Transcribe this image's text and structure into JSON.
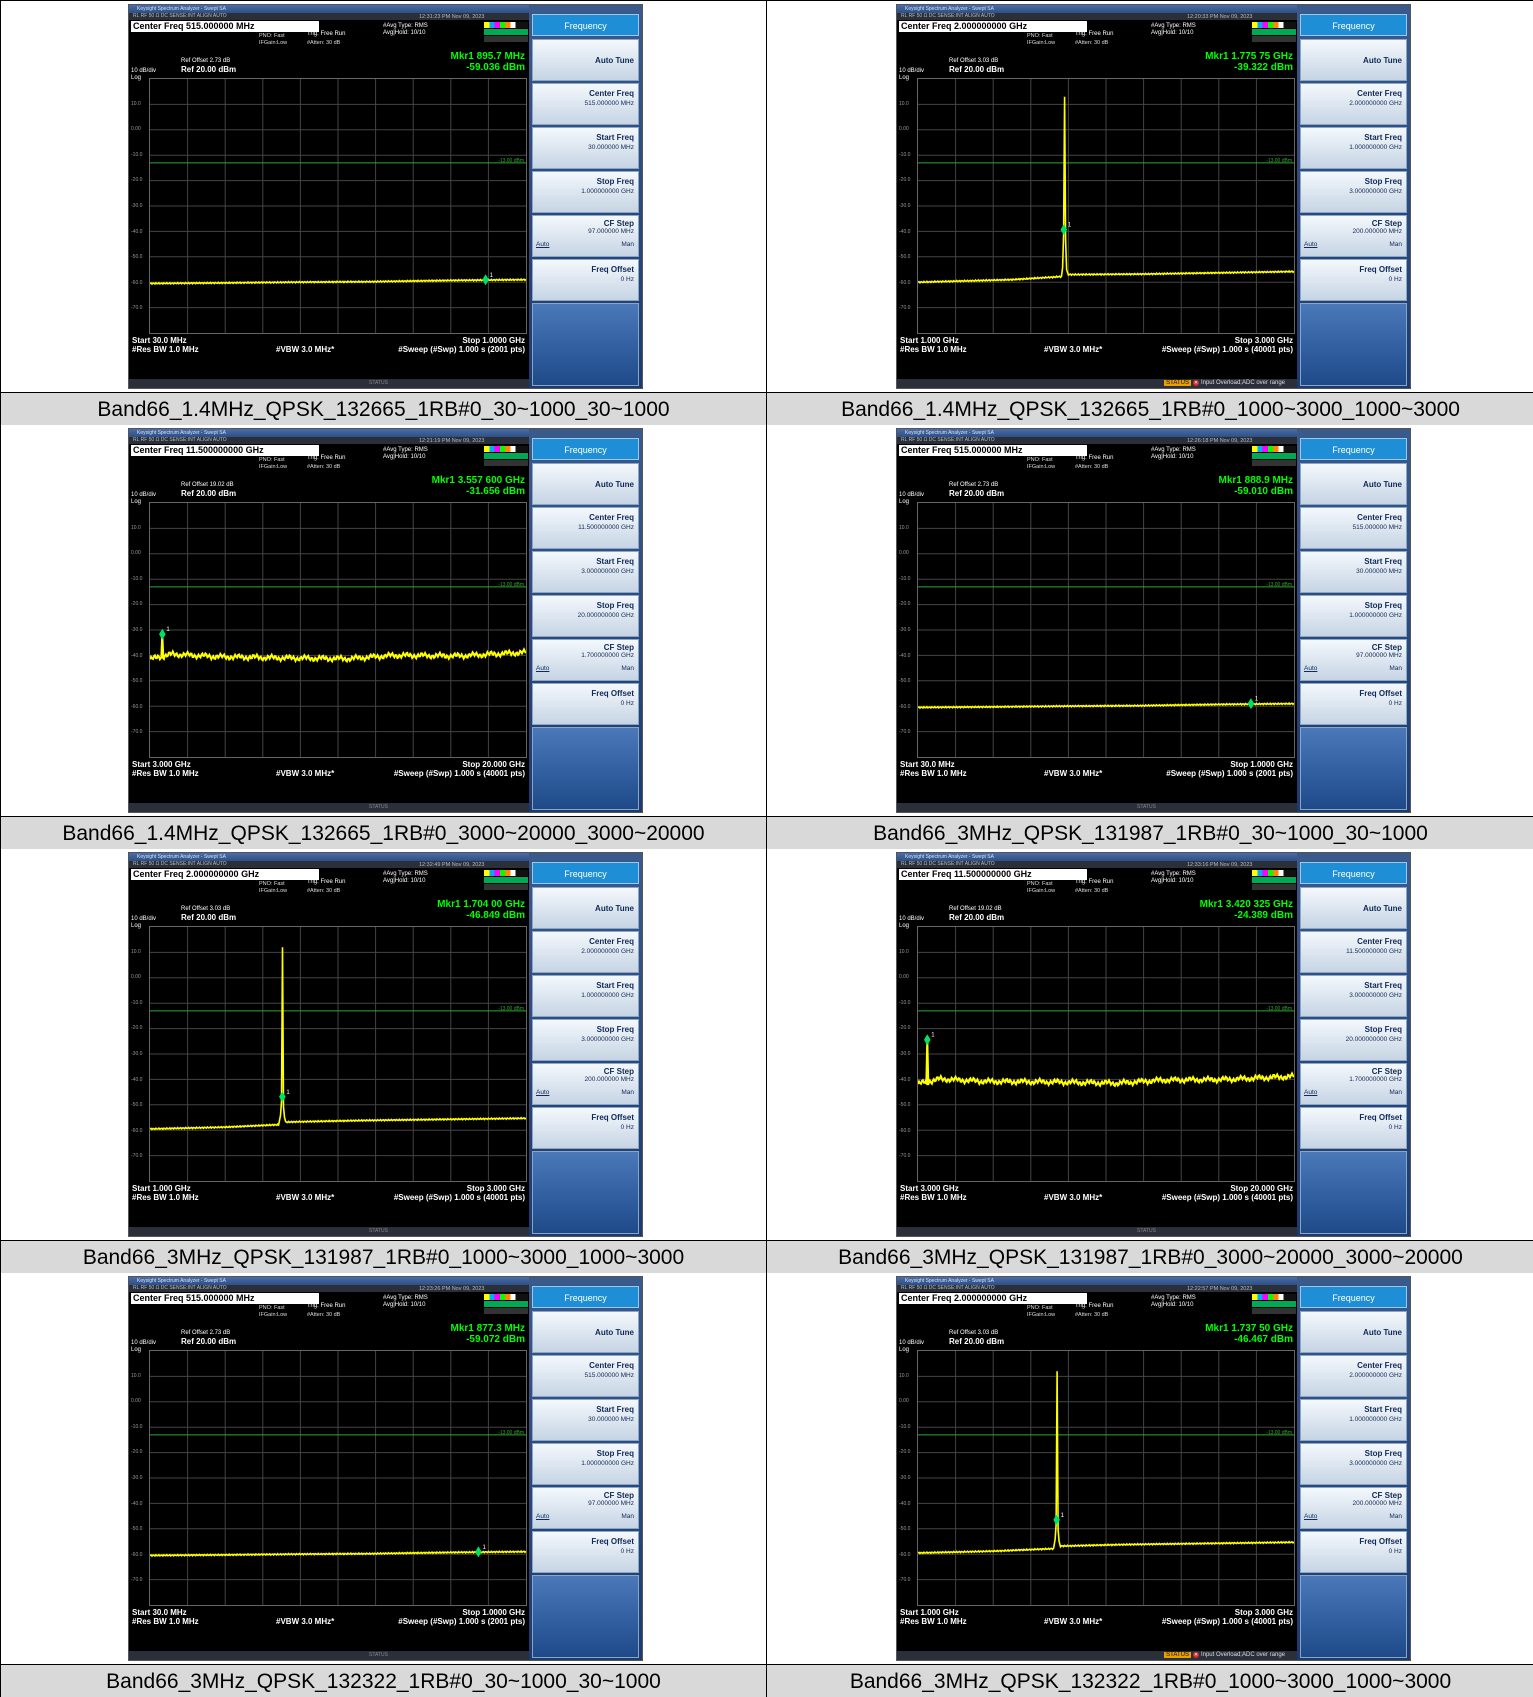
{
  "captions": [
    "Band66_1.4MHz_QPSK_132665_1RB#0_30~1000_30~1000",
    "Band66_1.4MHz_QPSK_132665_1RB#0_1000~3000_1000~3000",
    "Band66_1.4MHz_QPSK_132665_1RB#0_3000~20000_3000~20000",
    "Band66_3MHz_QPSK_131987_1RB#0_30~1000_30~1000",
    "Band66_3MHz_QPSK_131987_1RB#0_1000~3000_1000~3000",
    "Band66_3MHz_QPSK_131987_1RB#0_3000~20000_3000~20000",
    "Band66_3MHz_QPSK_132322_1RB#0_30~1000_30~1000",
    "Band66_3MHz_QPSK_132322_1RB#0_1000~3000_1000~3000"
  ],
  "common": {
    "window_title": "Keysight Spectrum Analyzer - Swept SA",
    "status_left": "RL          RF     50 Ω  DC                SENSE:INT                  ALIGN AUTO",
    "avg_type": "#Avg Type: RMS",
    "avg_hold": "Avg|Hold: 10/10",
    "pno": "PNO: Fast",
    "ifgain": "IFGain:Low",
    "trig": "Trig: Free Run",
    "atten": "#Atten: 30 dB",
    "ref_level": "Ref 20.00 dBm",
    "scale": "10 dB/div",
    "log": "Log",
    "res_bw": "#Res BW 1.0 MHz",
    "vbw": "#VBW 3.0 MHz*",
    "status_label": "STATUS",
    "menu_title": "Frequency",
    "auto_tune": "Auto Tune",
    "center_freq_lbl": "Center Freq",
    "start_freq_lbl": "Start Freq",
    "stop_freq_lbl": "Stop Freq",
    "cf_step_lbl": "CF Step",
    "freq_offset_lbl": "Freq Offset",
    "freq_offset_val": "0 Hz",
    "auto": "Auto",
    "man": "Man",
    "overload_msg": "Input Overload;ADC over range",
    "y_labels": [
      "10.0",
      "0.00",
      "-10.0",
      "-20.0",
      "-30.0",
      "-40.0",
      "-50.0",
      "-60.0",
      "-70.0"
    ],
    "limit_label": "-13.00 dBm"
  },
  "shots": [
    {
      "time": "12:31:23 PM Nov 09, 2023",
      "center": "Center Freq 515.000000 MHz",
      "ref_offset": "Ref Offset 2.73 dB",
      "mkr_freq": "Mkr1 895.7 MHz",
      "mkr_amp": "-59.036 dBm",
      "start": "Start 30.0 MHz",
      "stop": "Stop 1.0000 GHz",
      "sweep": "#Sweep (#Swp)  1.000 s (2001 pts)",
      "m_center": "515.000000 MHz",
      "m_start": "30.000000 MHz",
      "m_stop": "1.000000000 GHz",
      "m_cfstep": "97.000000 MHz",
      "overload": false,
      "chart_data": {
        "type": "line",
        "x_range": [
          30,
          1000
        ],
        "x_unit": "MHz",
        "ylim": [
          -80,
          20
        ],
        "limit_dBm": -13,
        "marker": {
          "x": 895.7,
          "y": -59.036
        },
        "series": [
          {
            "x": [
              30,
              200,
              400,
              600,
              800,
              1000
            ],
            "values": [
              -60.5,
              -60.3,
              -60.0,
              -59.8,
              -59.3,
              -59.0
            ]
          }
        ]
      }
    },
    {
      "time": "12:20:33 PM Nov 09, 2023",
      "center": "Center Freq 2.000000000 GHz",
      "ref_offset": "Ref Offset 3.03 dB",
      "mkr_freq": "Mkr1 1.775 75 GHz",
      "mkr_amp": "-39.322 dBm",
      "start": "Start 1.000 GHz",
      "stop": "Stop 3.000 GHz",
      "sweep": "#Sweep (#Swp)  1.000 s (40001 pts)",
      "m_center": "2.000000000 GHz",
      "m_start": "1.000000000 GHz",
      "m_stop": "3.000000000 GHz",
      "m_cfstep": "200.000000 MHz",
      "overload": true,
      "chart_data": {
        "type": "line",
        "x_range": [
          1000,
          3000
        ],
        "x_unit": "MHz",
        "ylim": [
          -80,
          20
        ],
        "limit_dBm": -13,
        "marker": {
          "x": 1775.75,
          "y": -39.322
        },
        "peak": {
          "x": 1780,
          "y": 13
        },
        "series": [
          {
            "x": [
              1000,
              1500,
              1760,
              1800,
              2200,
              2600,
              3000
            ],
            "values": [
              -60.0,
              -59.0,
              -57.8,
              -57.0,
              -56.8,
              -56.3,
              -55.8
            ]
          }
        ]
      }
    },
    {
      "time": "12:21:19 PM Nov 09, 2023",
      "center": "Center Freq 11.500000000 GHz",
      "ref_offset": "Ref Offset 19.02 dB",
      "mkr_freq": "Mkr1 3.557 600 GHz",
      "mkr_amp": "-31.656 dBm",
      "start": "Start 3.000 GHz",
      "stop": "Stop 20.000 GHz",
      "sweep": "#Sweep (#Swp)  1.000 s (40001 pts)",
      "m_center": "11.500000000 GHz",
      "m_start": "3.000000000 GHz",
      "m_stop": "20.000000000 GHz",
      "m_cfstep": "1.700000000 GHz",
      "overload": false,
      "chart_data": {
        "type": "line",
        "x_range": [
          3000,
          20000
        ],
        "x_unit": "MHz",
        "ylim": [
          -80,
          20
        ],
        "limit_dBm": -13,
        "marker": {
          "x": 3557.6,
          "y": -31.656
        },
        "series": [
          {
            "x": [
              3000,
              4000,
              6000,
              9000,
              12000,
              14000,
              17000,
              20000
            ],
            "values": [
              -41.5,
              -39.5,
              -40.5,
              -41.0,
              -41.3,
              -40.0,
              -40.2,
              -38.8
            ]
          }
        ]
      }
    },
    {
      "time": "12:26:18 PM Nov 09, 2023",
      "center": "Center Freq 515.000000 MHz",
      "ref_offset": "Ref Offset 2.73 dB",
      "mkr_freq": "Mkr1 888.9 MHz",
      "mkr_amp": "-59.010 dBm",
      "start": "Start 30.0 MHz",
      "stop": "Stop 1.0000 GHz",
      "sweep": "#Sweep (#Swp)  1.000 s (2001 pts)",
      "m_center": "515.000000 MHz",
      "m_start": "30.000000 MHz",
      "m_stop": "1.000000000 GHz",
      "m_cfstep": "97.000000 MHz",
      "overload": false,
      "chart_data": {
        "type": "line",
        "x_range": [
          30,
          1000
        ],
        "x_unit": "MHz",
        "ylim": [
          -80,
          20
        ],
        "limit_dBm": -13,
        "marker": {
          "x": 888.9,
          "y": -59.01
        },
        "series": [
          {
            "x": [
              30,
              200,
              400,
              600,
              800,
              1000
            ],
            "values": [
              -60.5,
              -60.3,
              -60.0,
              -59.8,
              -59.3,
              -59.0
            ]
          }
        ]
      }
    },
    {
      "time": "12:32:49 PM Nov 09, 2023",
      "center": "Center Freq 2.000000000 GHz",
      "ref_offset": "Ref Offset 3.03 dB",
      "mkr_freq": "Mkr1 1.704 00 GHz",
      "mkr_amp": "-46.849 dBm",
      "start": "Start 1.000 GHz",
      "stop": "Stop 3.000 GHz",
      "sweep": "#Sweep (#Swp)  1.000 s (40001 pts)",
      "m_center": "2.000000000 GHz",
      "m_start": "1.000000000 GHz",
      "m_stop": "3.000000000 GHz",
      "m_cfstep": "200.000000 MHz",
      "overload": false,
      "chart_data": {
        "type": "line",
        "x_range": [
          1000,
          3000
        ],
        "x_unit": "MHz",
        "ylim": [
          -80,
          20
        ],
        "limit_dBm": -13,
        "marker": {
          "x": 1704,
          "y": -46.849
        },
        "peak": {
          "x": 1705,
          "y": 12
        },
        "series": [
          {
            "x": [
              1000,
              1400,
              1690,
              1720,
              2100,
              2500,
              3000
            ],
            "values": [
              -59.5,
              -58.8,
              -57.8,
              -56.8,
              -56.2,
              -55.8,
              -55.3
            ]
          }
        ]
      }
    },
    {
      "time": "12:33:16 PM Nov 09, 2023",
      "center": "Center Freq 11.500000000 GHz",
      "ref_offset": "Ref Offset 19.02 dB",
      "mkr_freq": "Mkr1 3.420 325 GHz",
      "mkr_amp": "-24.389 dBm",
      "start": "Start 3.000 GHz",
      "stop": "Stop 20.000 GHz",
      "sweep": "#Sweep (#Swp)  1.000 s (40001 pts)",
      "m_center": "11.500000000 GHz",
      "m_start": "3.000000000 GHz",
      "m_stop": "20.000000000 GHz",
      "m_cfstep": "1.700000000 GHz",
      "overload": false,
      "chart_data": {
        "type": "line",
        "x_range": [
          3000,
          20000
        ],
        "x_unit": "MHz",
        "ylim": [
          -80,
          20
        ],
        "limit_dBm": -13,
        "marker": {
          "x": 3420.325,
          "y": -24.389
        },
        "series": [
          {
            "x": [
              3000,
              4000,
              6000,
              9000,
              12000,
              14000,
              17000,
              20000
            ],
            "values": [
              -41.8,
              -39.8,
              -40.8,
              -41.0,
              -41.5,
              -40.3,
              -40.0,
              -38.8
            ]
          }
        ]
      }
    },
    {
      "time": "12:23:26 PM Nov 09, 2023",
      "center": "Center Freq 515.000000 MHz",
      "ref_offset": "Ref Offset 2.73 dB",
      "mkr_freq": "Mkr1 877.3 MHz",
      "mkr_amp": "-59.072 dBm",
      "start": "Start 30.0 MHz",
      "stop": "Stop 1.0000 GHz",
      "sweep": "#Sweep (#Swp)  1.000 s (2001 pts)",
      "m_center": "515.000000 MHz",
      "m_start": "30.000000 MHz",
      "m_stop": "1.000000000 GHz",
      "m_cfstep": "97.000000 MHz",
      "overload": false,
      "chart_data": {
        "type": "line",
        "x_range": [
          30,
          1000
        ],
        "x_unit": "MHz",
        "ylim": [
          -80,
          20
        ],
        "limit_dBm": -13,
        "marker": {
          "x": 877.3,
          "y": -59.072
        },
        "series": [
          {
            "x": [
              30,
              200,
              400,
              600,
              800,
              1000
            ],
            "values": [
              -60.5,
              -60.3,
              -60.0,
              -59.8,
              -59.3,
              -59.0
            ]
          }
        ]
      }
    },
    {
      "time": "12:22:57 PM Nov 09, 2023",
      "center": "Center Freq 2.000000000 GHz",
      "ref_offset": "Ref Offset 3.03 dB",
      "mkr_freq": "Mkr1 1.737 50 GHz",
      "mkr_amp": "-46.467 dBm",
      "start": "Start 1.000 GHz",
      "stop": "Stop 3.000 GHz",
      "sweep": "#Sweep (#Swp)  1.000 s (40001 pts)",
      "m_center": "2.000000000 GHz",
      "m_start": "1.000000000 GHz",
      "m_stop": "3.000000000 GHz",
      "m_cfstep": "200.000000 MHz",
      "overload": true,
      "chart_data": {
        "type": "line",
        "x_range": [
          1000,
          3000
        ],
        "x_unit": "MHz",
        "ylim": [
          -80,
          20
        ],
        "limit_dBm": -13,
        "marker": {
          "x": 1737.5,
          "y": -46.467
        },
        "peak": {
          "x": 1740,
          "y": 12
        },
        "series": [
          {
            "x": [
              1000,
              1400,
              1725,
              1760,
              2100,
              2500,
              3000
            ],
            "values": [
              -59.5,
              -58.8,
              -57.8,
              -56.8,
              -56.2,
              -55.8,
              -55.3
            ]
          }
        ]
      }
    }
  ]
}
